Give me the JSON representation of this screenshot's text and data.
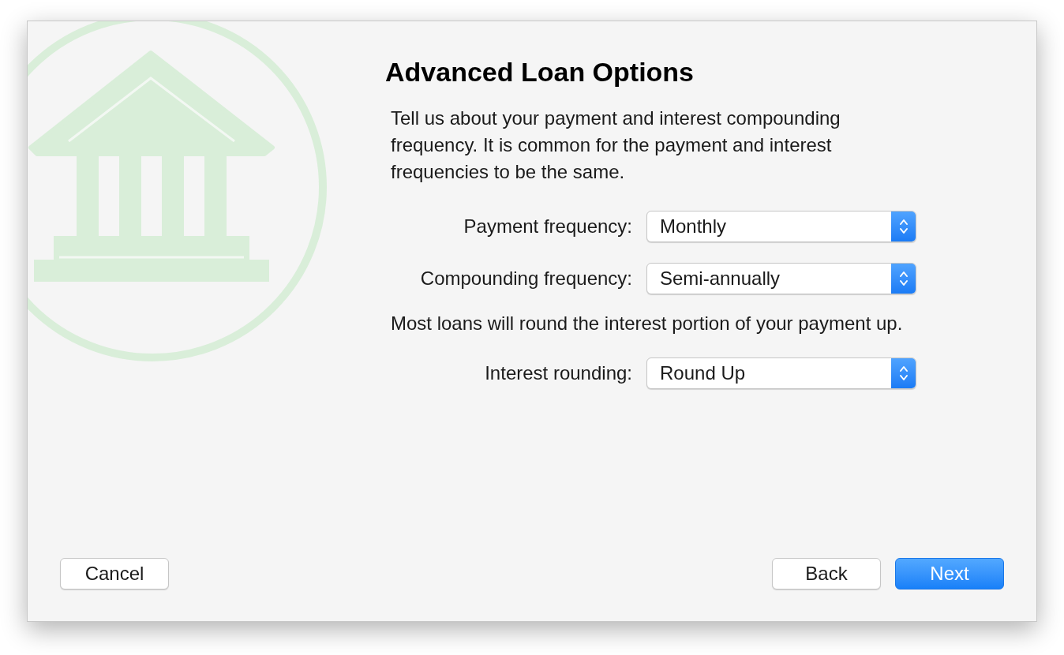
{
  "heading": "Advanced Loan Options",
  "description": "Tell us about your payment and interest compounding frequency. It is common for the payment and interest frequencies to be the same.",
  "rows": [
    {
      "kind": "select",
      "label": "Payment frequency:",
      "value": "Monthly"
    },
    {
      "kind": "select",
      "label": "Compounding frequency:",
      "value": "Semi-annually"
    },
    {
      "kind": "note",
      "text": "Most loans will round the interest portion of your payment up."
    },
    {
      "kind": "select",
      "label": "Interest rounding:",
      "value": "Round Up"
    }
  ],
  "left_buttons": [
    {
      "label": "Cancel",
      "kind": "default"
    }
  ],
  "right_buttons": [
    {
      "label": "Back",
      "kind": "default"
    },
    {
      "label": "Next",
      "kind": "primary"
    }
  ]
}
